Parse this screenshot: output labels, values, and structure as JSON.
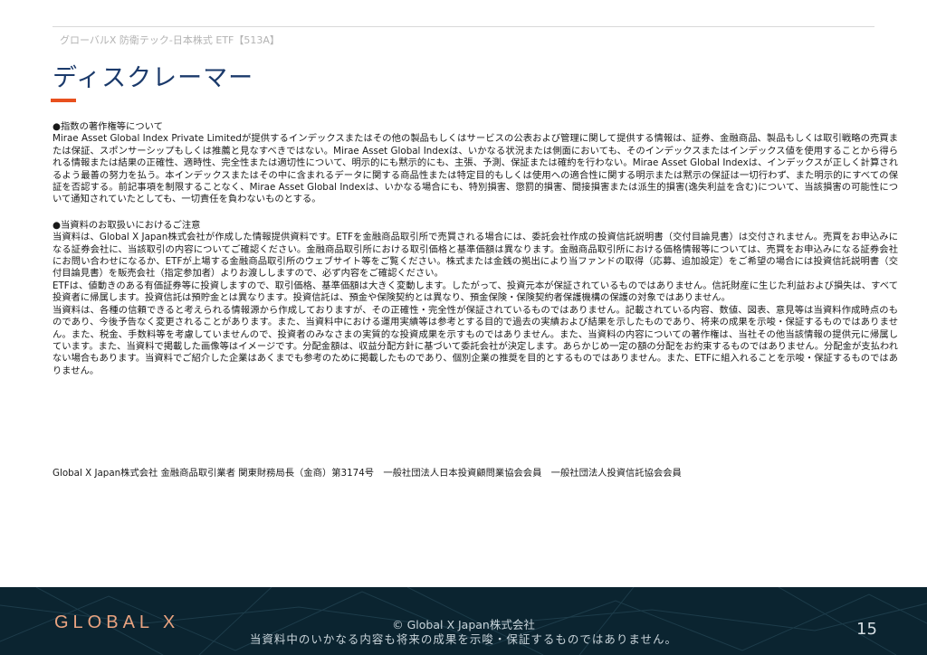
{
  "header": {
    "breadcrumb": "グローバルX 防衛テック-日本株式 ETF【513A】",
    "title": "ディスクレーマー"
  },
  "sections": {
    "index_heading": "●指数の著作権等について",
    "index_body": "Mirae Asset Global Index Private Limitedが提供するインデックスまたはその他の製品もしくはサービスの公表および管理に関して提供する情報は、証券、金融商品、製品もしくは取引戦略の売買または保証、スポンサーシップもしくは推薦と見なすべきではない。Mirae Asset Global Indexは、いかなる状況または側面においても、そのインデックスまたはインデックス値を使用することから得られる情報または結果の正確性、適時性、完全性または適切性について、明示的にも黙示的にも、主張、予測、保証または確約を行わない。Mirae Asset Global Indexは、インデックスが正しく計算されるよう最善の努力を払う。本インデックスまたはその中に含まれるデータに関する商品性または特定目的もしくは使用への適合性に関する明示または黙示の保証は一切行わず、また明示的にすべての保証を否認する。前記事項を制限することなく、Mirae Asset Global Indexは、いかなる場合にも、特別損害、懲罰的損害、間接損害または派生的損害(逸失利益を含む)について、当該損害の可能性について通知されていたとしても、一切責任を負わないものとする。",
    "handling_heading": "●当資料のお取扱いにおけるご注意",
    "handling_p1": "当資料は、Global X Japan株式会社が作成した情報提供資料です。ETFを金融商品取引所で売買される場合には、委託会社作成の投資信託説明書（交付目論見書）は交付されません。売買をお申込みになる証券会社に、当該取引の内容についてご確認ください。金融商品取引所における取引価格と基準価額は異なります。金融商品取引所における価格情報等については、売買をお申込みになる証券会社にお問い合わせになるか、ETFが上場する金融商品取引所のウェブサイト等をご覧ください。株式または金銭の拠出により当ファンドの取得（応募、追加設定）をご希望の場合には投資信託説明書（交付目論見書）を販売会社（指定参加者）よりお渡ししますので、必ず内容をご確認ください。",
    "handling_p2": "ETFは、値動きのある有価証券等に投資しますので、取引価格、基準価額は大きく変動します。したがって、投資元本が保証されているものではありません。信託財産に生じた利益および損失は、すべて投資者に帰属します。投資信託は預貯金とは異なります。投資信託は、預金や保険契約とは異なり、預金保険・保険契約者保護機構の保護の対象ではありません。",
    "handling_p3": "当資料は、各種の信頼できると考えられる情報源から作成しておりますが、その正確性・完全性が保証されているものではありません。記載されている内容、数値、図表、意見等は当資料作成時点のものであり、今後予告なく変更されることがあります。また、当資料中における運用実績等は参考とする目的で過去の実績および結果を示したものであり、将来の成果を示唆・保証するものではありません。また、税金、手数料等を考慮していませんので、投資者のみなさまの実質的な投資成果を示すものではありません。また、当資料の内容についての著作権は、当社その他当該情報の提供元に帰属しています。また、当資料で掲載した画像等はイメージです。分配金額は、収益分配方針に基づいて委託会社が決定します。あらかじめ一定の額の分配をお約束するものではありません。分配金が支払われない場合もあります。当資料でご紹介した企業はあくまでも参考のために掲載したものであり、個別企業の推奨を目的とするものではありません。また、ETFに組入れることを示唆・保証するものではありません。"
  },
  "registration": "Global X Japan株式会社 金融商品取引業者 関東財務局長（金商）第3174号　一般社団法人日本投資顧問業協会会員　一般社団法人投資信託協会会員",
  "footer": {
    "logo": "GLOBAL X",
    "copyright": "© Global X Japan株式会社",
    "note": "当資料中のいかなる内容も将来の成果を示唆・保証するものではありません。",
    "page_number": "15"
  },
  "colors": {
    "title": "#1b3a6b",
    "accent": "#e8501e",
    "footer_bg": "#0b2430",
    "logo": "#e9a380"
  }
}
